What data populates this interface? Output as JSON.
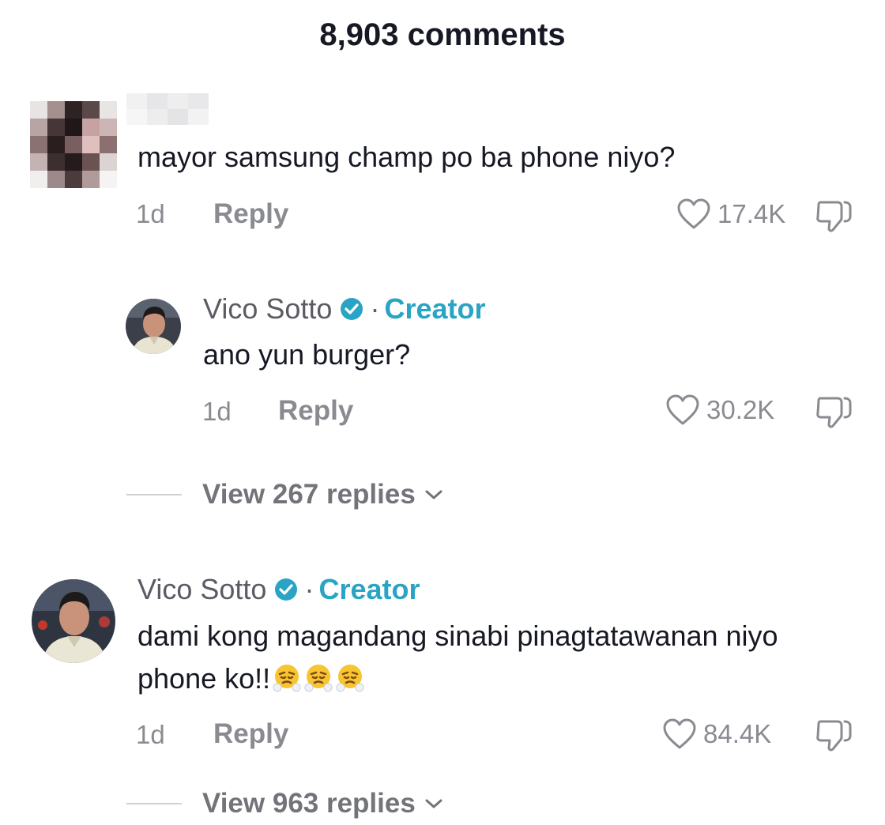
{
  "header": {
    "title": "8,903 comments"
  },
  "comments": [
    {
      "username": "",
      "text": "mayor samsung champ po ba phone niyo?",
      "time": "1d",
      "reply_label": "Reply",
      "likes": "17.4K"
    },
    {
      "username": "Vico Sotto",
      "creator_label": "Creator",
      "separator": "·",
      "text": "ano yun burger?",
      "time": "1d",
      "reply_label": "Reply",
      "likes": "30.2K",
      "view_replies": "View 267 replies"
    },
    {
      "username": "Vico Sotto",
      "creator_label": "Creator",
      "separator": "·",
      "text_line1": "dami kong magandang sinabi pinagtatawanan niyo",
      "text_line2": "phone ko!!",
      "time": "1d",
      "reply_label": "Reply",
      "likes": "84.4K",
      "view_replies": "View 963 replies"
    }
  ],
  "colors": {
    "accent": "#2aa4c4",
    "muted": "#8a8b91",
    "text": "#161823"
  },
  "icons": [
    "heart-icon",
    "dislike-icon",
    "verified-badge-icon",
    "chevron-down-icon",
    "steam-nose-emoji"
  ]
}
